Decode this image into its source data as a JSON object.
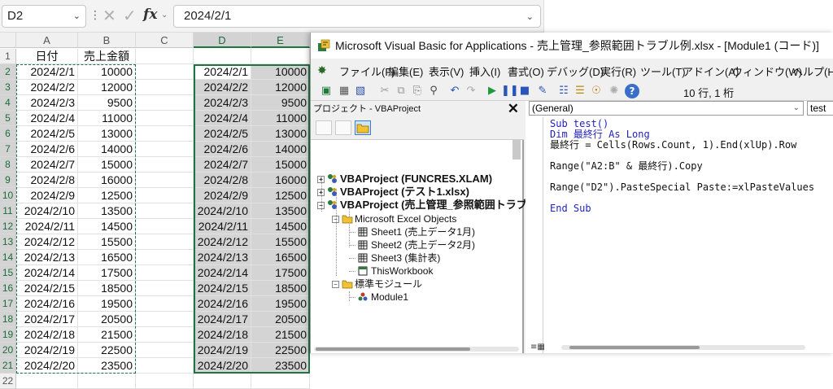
{
  "formula_bar": {
    "name_box": "D2",
    "cancel_icon": "✕",
    "enter_icon": "✓",
    "fx_label": "fx",
    "formula": "2024/2/1"
  },
  "sheet": {
    "columns": [
      "A",
      "B",
      "C",
      "D",
      "E"
    ],
    "rows": [
      "1",
      "2",
      "3",
      "4",
      "5",
      "6",
      "7",
      "8",
      "9",
      "10",
      "11",
      "12",
      "13",
      "14",
      "15",
      "16",
      "17",
      "18",
      "19",
      "20",
      "21",
      "22"
    ],
    "header_a": "日付",
    "header_b": "売上金額",
    "dates": [
      "2024/2/1",
      "2024/2/2",
      "2024/2/3",
      "2024/2/4",
      "2024/2/5",
      "2024/2/6",
      "2024/2/7",
      "2024/2/8",
      "2024/2/9",
      "2024/2/10",
      "2024/2/11",
      "2024/2/12",
      "2024/2/13",
      "2024/2/14",
      "2024/2/15",
      "2024/2/16",
      "2024/2/17",
      "2024/2/18",
      "2024/2/19",
      "2024/2/20"
    ],
    "amounts": [
      "10000",
      "12000",
      "9500",
      "11000",
      "13000",
      "14000",
      "15000",
      "16000",
      "12500",
      "13500",
      "14500",
      "15500",
      "16500",
      "17500",
      "18500",
      "19500",
      "20500",
      "21500",
      "22500",
      "23500"
    ]
  },
  "vbe": {
    "title": "Microsoft Visual Basic for Applications - 売上管理_参照範囲トラブル例.xlsx - [Module1 (コード)]",
    "menu": [
      "ファイル(F)",
      "編集(E)",
      "表示(V)",
      "挿入(I)",
      "書式(O)",
      "デバッグ(D)",
      "実行(R)",
      "ツール(T)",
      "アドイン(A)",
      "ウィンドウ(W)",
      "ヘルプ(H)"
    ],
    "position": "10 行, 1 桁",
    "project_title": "プロジェクト - VBAProject",
    "tree": {
      "p1": "VBAProject (FUNCRES.XLAM)",
      "p2": "VBAProject (テスト1.xlsx)",
      "p3": "VBAProject (売上管理_参照範囲トラブル",
      "excel_objects": "Microsoft Excel Objects",
      "sheet1": "Sheet1 (売上データ1月)",
      "sheet2": "Sheet2 (売上データ2月)",
      "sheet3": "Sheet3 (集計表)",
      "thisworkbook": "ThisWorkbook",
      "modules": "標準モジュール",
      "module1": "Module1"
    },
    "object_combo": "(General)",
    "proc_combo": "test",
    "code": [
      "Sub test()",
      "Dim 最終行 As Long",
      "最終行 = Cells(Rows.Count, 1).End(xlUp).Row",
      "",
      "Range(\"A2:B\" & 最終行).Copy",
      "",
      "Range(\"D2\").PasteSpecial Paste:=xlPasteValues",
      "",
      "End Sub"
    ]
  }
}
